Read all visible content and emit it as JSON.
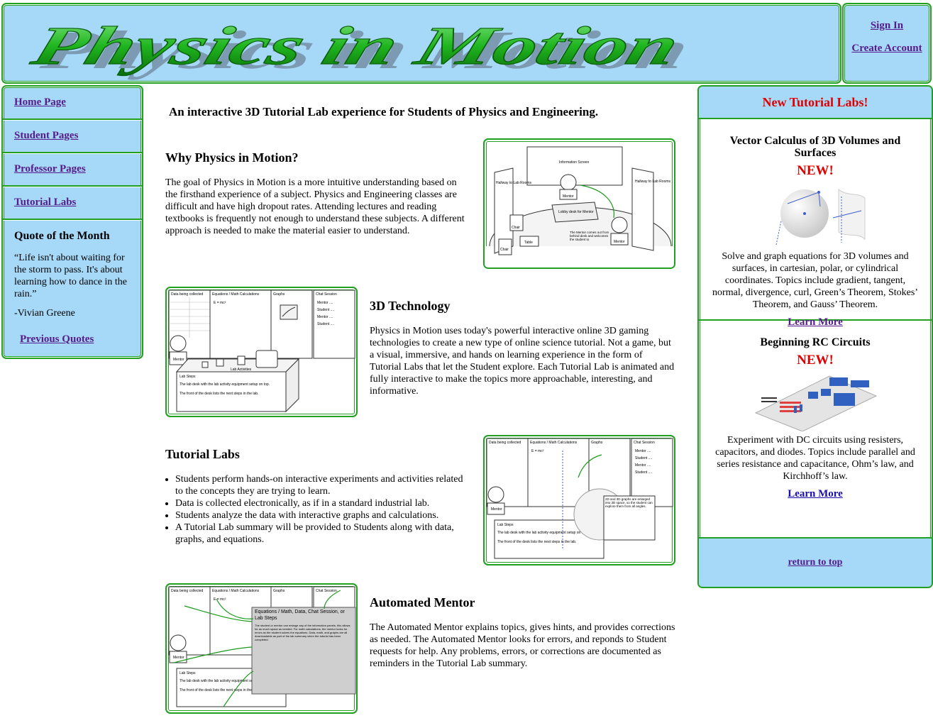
{
  "header": {
    "logo_text": "Physics in Motion"
  },
  "account": {
    "sign_in": "Sign In",
    "create_account": "Create Account"
  },
  "nav": {
    "items": [
      "Home Page",
      "Student Pages",
      "Professor Pages",
      "Tutorial Labs"
    ],
    "quote_title": "Quote of the Month",
    "quote_text": "“Life isn't about waiting for the storm to pass. It's about learning how to dance in the rain.”",
    "quote_author": "-Vivian Greene",
    "previous_quotes": "Previous Quotes"
  },
  "main": {
    "tagline": "An interactive 3D Tutorial Lab experience for Students of Physics and Engineering.",
    "why": {
      "title": "Why Physics in Motion?",
      "body": "The goal of Physics in Motion is a more intuitive understanding based on the firsthand experience of a subject. Physics and Engineering classes are difficult and have high dropout rates. Attending lectures and reading textbooks is frequently not enough to understand these subjects. A different approach is needed to make the material easier to understand."
    },
    "tech": {
      "title": "3D Technology",
      "body": "Physics in Motion uses today's powerful interactive online 3D gaming technologies to create a new type of online science tutorial. Not a game, but a visual, immersive, and hands on learning experience in the form of Tutorial Labs that let the Student explore. Each Tutorial Lab is animated and fully interactive to make the topics more approachable, interesting, and informative."
    },
    "labs": {
      "title": "Tutorial Labs",
      "bullets": [
        "Students perform hands-on interactive experiments and activities related to the concepts they are trying to learn.",
        "Data is collected electronically, as if in a standard industrial lab.",
        "Students analyze the data with interactive graphs and calculations.",
        "A Tutorial Lab summary will be provided to Students along with data, graphs, and equations."
      ]
    },
    "mentor": {
      "title": "Automated Mentor",
      "body": "The Automated Mentor explains topics, gives hints, and provides corrections as needed. The Automated Mentor looks for errors, and reponds to Student requests for help. Any problems, errors, or corrections are documented as reminders in the Tutorial Lab summary."
    },
    "fig1": {
      "info_screen": "Information Screen",
      "hall_left": "Hallway to Lab Rooms",
      "hall_right": "Hallway to Lab Rooms",
      "mentor": "Mentor",
      "lobby_desk": "Lobby desk for Mentor",
      "chair": "Chair",
      "table": "Table",
      "note": "The Mentor comes out from behind desk and welcomes the student to"
    },
    "panels": {
      "data": "Data being collected",
      "equations": "Equations / Math Calculations",
      "graphs": "Graphs",
      "chat": "Chat Session",
      "chat_lines": [
        "Mentor ....",
        "Student ....",
        "Mentor ....",
        "Student ...."
      ],
      "formula": "E = mc²",
      "mentor": "Mentor",
      "lab_activities": "Lab Activities",
      "lab_steps": "Lab Steps",
      "step1": "The lab desk with the lab activity equipment setup on top.",
      "step2": "The front of the desk lists the next steps in the lab."
    },
    "fig3_note": "2D and 3D graphs are enlarged into 3D space, so the student can explore them from all angles.",
    "fig4": {
      "popup_title": "Equations / Math, Data, Chat Session, or Lab Steps",
      "popup_body": "The student or mentor can enlarge any of the information panels, this allows for as much space as needed. For math calculations, the mentor looks for errors as the student solves the equations. Data, math, and graphs are all downloadable as part of the lab summary when the tutorial has been completed."
    }
  },
  "right": {
    "header": "New Tutorial Labs!",
    "items": [
      {
        "title": "Vector Calculus of 3D Volumes and Surfaces",
        "badge": "NEW!",
        "body": "Solve and graph equations for 3D volumes and surfaces, in cartesian, polar, or cylindrical coordinates. Topics include gradient, tangent, normal, divergence, curl, Green’s Theorem, Stokes’ Theorem, and Gauss’ Theorem.",
        "link": "Learn More"
      },
      {
        "title": "Beginning RC Circuits",
        "badge": "NEW!",
        "body": "Experiment with DC circuits using resisters, capacitors, and diodes. Topics include parallel and series resistance and capacitance, Ohm’s law, and Kirchhoff’s law.",
        "link": "Learn More"
      }
    ],
    "return_top": "return to top"
  },
  "colors": {
    "panel_bg": "#a6d8f7",
    "border": "#22a022",
    "accent_red": "#e00000",
    "link": "#551a8b"
  }
}
